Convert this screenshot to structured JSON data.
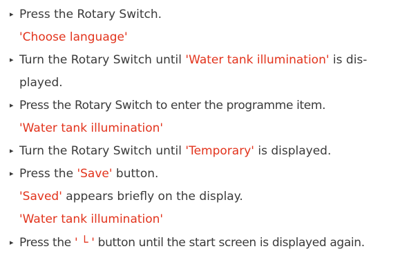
{
  "instructions": {
    "l1": {
      "text": "Press the Rotary Switch."
    },
    "l2": {
      "display": "'Choose language'"
    },
    "l3": {
      "pre": "Turn the Rotary Switch until ",
      "display": "'Water tank illumination'",
      "post": " is dis-"
    },
    "l4": {
      "text": "played."
    },
    "l5": {
      "text": "Press the Rotary Switch to enter the programme item."
    },
    "l6": {
      "display": "'Water tank illumination'"
    },
    "l7": {
      "pre": "Turn the Rotary Switch until ",
      "display": "'Temporary'",
      "post": " is displayed."
    },
    "l8": {
      "pre": "Press the ",
      "display": "'Save'",
      "post": " button."
    },
    "l9": {
      "display": "'Saved'",
      "post": " appears briefly on the display."
    },
    "l10": {
      "display": "'Water tank illumination'"
    },
    "l11": {
      "pre": "Press the ",
      "display": "' └ '",
      "post": " button until the start screen is displayed again."
    }
  },
  "bullet_glyph": "▸",
  "colors": {
    "text": "#3a3a3a",
    "display_text": "#e2331c"
  }
}
